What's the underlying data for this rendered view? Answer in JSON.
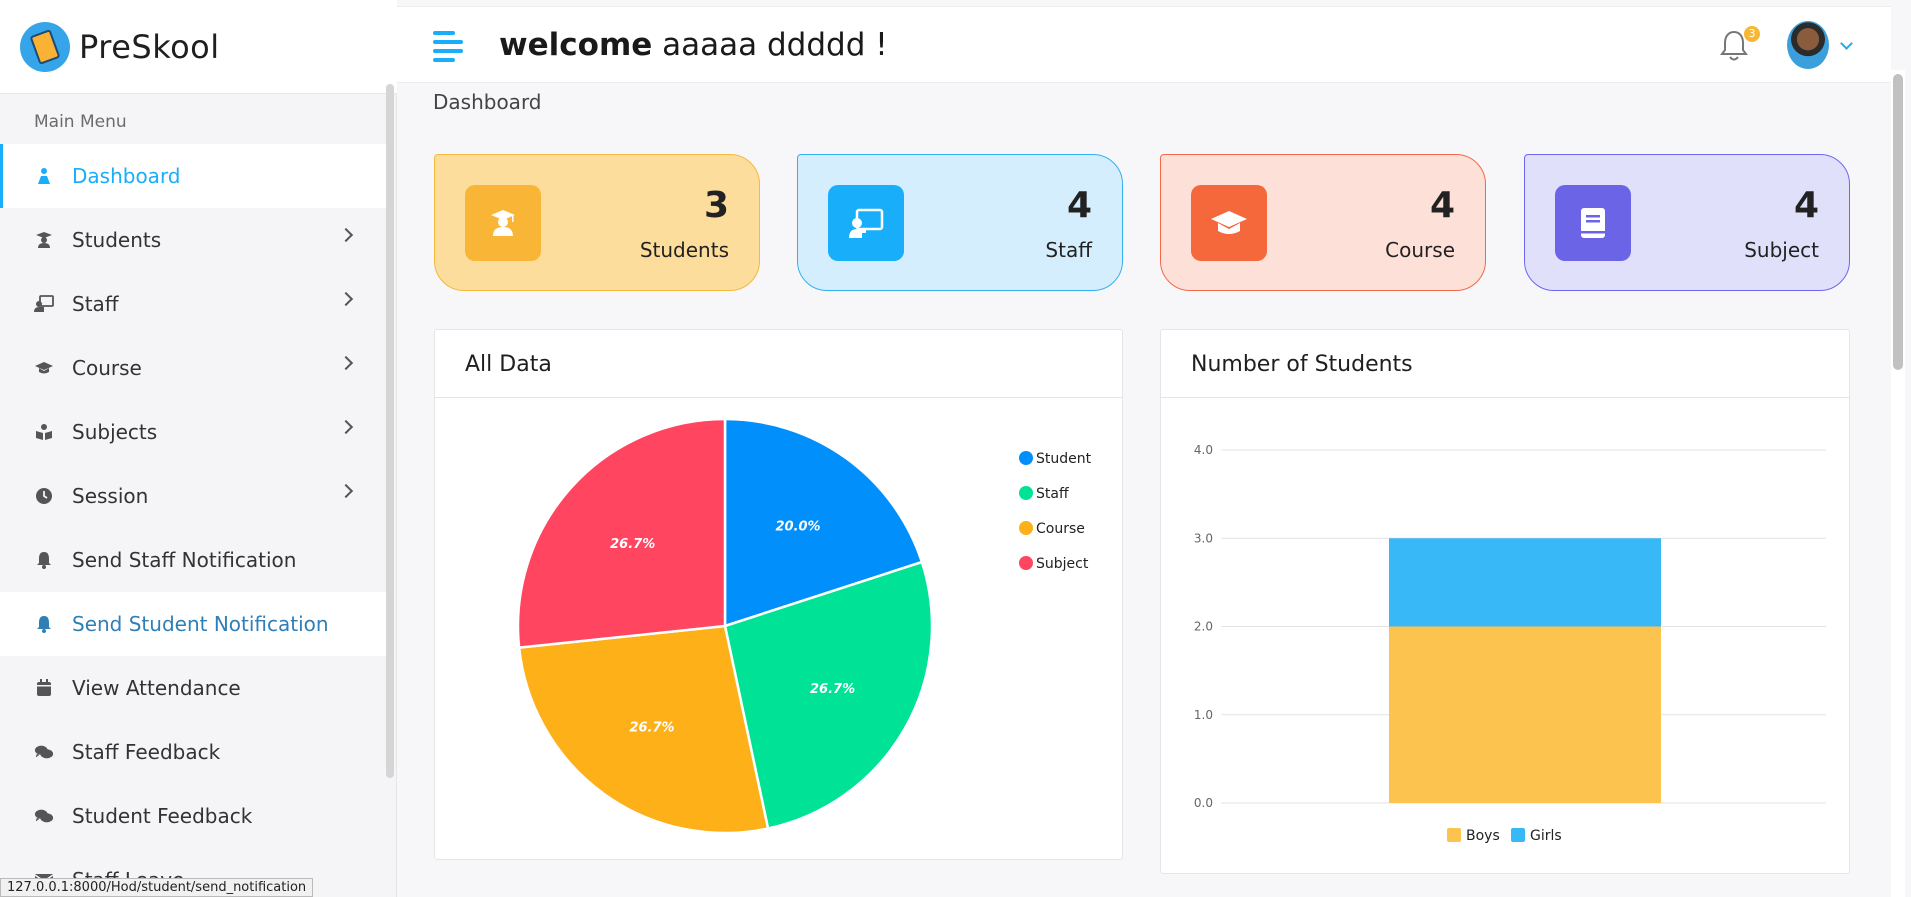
{
  "brand": {
    "name": "PreSkool"
  },
  "header": {
    "welcome_word": "welcome",
    "welcome_name": "aaaaa ddddd  !",
    "notification_count": "3"
  },
  "sidebar": {
    "menu_title": "Main Menu",
    "items": [
      {
        "label": "Dashboard",
        "icon": "dashboard-icon",
        "has_chevron": false,
        "state": "active"
      },
      {
        "label": "Students",
        "icon": "graduate-icon",
        "has_chevron": true
      },
      {
        "label": "Staff",
        "icon": "chalkboard-teacher-icon",
        "has_chevron": true
      },
      {
        "label": "Course",
        "icon": "mortarboard-icon",
        "has_chevron": true
      },
      {
        "label": "Subjects",
        "icon": "book-reader-icon",
        "has_chevron": true
      },
      {
        "label": "Session",
        "icon": "clock-icon",
        "has_chevron": true
      },
      {
        "label": "Send Staff Notification",
        "icon": "bell-icon",
        "has_chevron": false
      },
      {
        "label": "Send Student Notification",
        "icon": "bell-icon",
        "has_chevron": false,
        "state": "hover"
      },
      {
        "label": "View Attendance",
        "icon": "calendar-icon",
        "has_chevron": false
      },
      {
        "label": "Staff Feedback",
        "icon": "comments-icon",
        "has_chevron": false
      },
      {
        "label": "Student Feedback",
        "icon": "comments-icon",
        "has_chevron": false
      },
      {
        "label": "Staff Leave",
        "icon": "envelope-icon",
        "has_chevron": false
      }
    ]
  },
  "status_url": "127.0.0.1:8000/Hod/student/send_notification",
  "breadcrumb": "Dashboard",
  "stats": [
    {
      "value": "3",
      "label": "Students",
      "icon": "student-icon"
    },
    {
      "value": "4",
      "label": "Staff",
      "icon": "teacher-board-icon"
    },
    {
      "value": "4",
      "label": "Course",
      "icon": "graduation-cap-icon"
    },
    {
      "value": "4",
      "label": "Subject",
      "icon": "book-icon"
    }
  ],
  "colors": {
    "accent": "#18aefa",
    "pie_student": "#008ffb",
    "pie_staff": "#00e396",
    "pie_course": "#feb019",
    "pie_subject": "#ff4560",
    "bar_boys": "#fcc44f",
    "bar_girls": "#38b8f7"
  },
  "panels": {
    "all_data_title": "All Data",
    "students_title": "Number of Students"
  },
  "chart_data": [
    {
      "type": "pie",
      "title": "All Data",
      "categories": [
        "Student",
        "Staff",
        "Course",
        "Subject"
      ],
      "values": [
        3,
        4,
        4,
        4
      ],
      "labels": [
        "20.0%",
        "26.7%",
        "26.7%",
        "26.7%"
      ],
      "legend": "right"
    },
    {
      "type": "bar",
      "stacked": true,
      "title": "Number of Students",
      "categories": [
        ""
      ],
      "series": [
        {
          "name": "Boys",
          "values": [
            2
          ]
        },
        {
          "name": "Girls",
          "values": [
            1
          ]
        }
      ],
      "ylim": [
        0,
        4
      ],
      "yticks": [
        "0.0",
        "1.0",
        "2.0",
        "3.0",
        "4.0"
      ],
      "grid": true,
      "legend": "bottom"
    }
  ]
}
